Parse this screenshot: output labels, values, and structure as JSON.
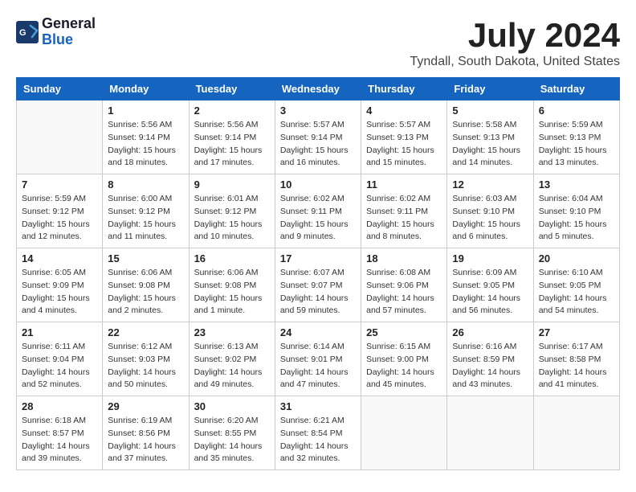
{
  "header": {
    "logo_line1": "General",
    "logo_line2": "Blue",
    "month_year": "July 2024",
    "location": "Tyndall, South Dakota, United States"
  },
  "days_of_week": [
    "Sunday",
    "Monday",
    "Tuesday",
    "Wednesday",
    "Thursday",
    "Friday",
    "Saturday"
  ],
  "weeks": [
    [
      {
        "day": "",
        "sunrise": "",
        "sunset": "",
        "daylight": ""
      },
      {
        "day": "1",
        "sunrise": "Sunrise: 5:56 AM",
        "sunset": "Sunset: 9:14 PM",
        "daylight": "Daylight: 15 hours and 18 minutes."
      },
      {
        "day": "2",
        "sunrise": "Sunrise: 5:56 AM",
        "sunset": "Sunset: 9:14 PM",
        "daylight": "Daylight: 15 hours and 17 minutes."
      },
      {
        "day": "3",
        "sunrise": "Sunrise: 5:57 AM",
        "sunset": "Sunset: 9:14 PM",
        "daylight": "Daylight: 15 hours and 16 minutes."
      },
      {
        "day": "4",
        "sunrise": "Sunrise: 5:57 AM",
        "sunset": "Sunset: 9:13 PM",
        "daylight": "Daylight: 15 hours and 15 minutes."
      },
      {
        "day": "5",
        "sunrise": "Sunrise: 5:58 AM",
        "sunset": "Sunset: 9:13 PM",
        "daylight": "Daylight: 15 hours and 14 minutes."
      },
      {
        "day": "6",
        "sunrise": "Sunrise: 5:59 AM",
        "sunset": "Sunset: 9:13 PM",
        "daylight": "Daylight: 15 hours and 13 minutes."
      }
    ],
    [
      {
        "day": "7",
        "sunrise": "Sunrise: 5:59 AM",
        "sunset": "Sunset: 9:12 PM",
        "daylight": "Daylight: 15 hours and 12 minutes."
      },
      {
        "day": "8",
        "sunrise": "Sunrise: 6:00 AM",
        "sunset": "Sunset: 9:12 PM",
        "daylight": "Daylight: 15 hours and 11 minutes."
      },
      {
        "day": "9",
        "sunrise": "Sunrise: 6:01 AM",
        "sunset": "Sunset: 9:12 PM",
        "daylight": "Daylight: 15 hours and 10 minutes."
      },
      {
        "day": "10",
        "sunrise": "Sunrise: 6:02 AM",
        "sunset": "Sunset: 9:11 PM",
        "daylight": "Daylight: 15 hours and 9 minutes."
      },
      {
        "day": "11",
        "sunrise": "Sunrise: 6:02 AM",
        "sunset": "Sunset: 9:11 PM",
        "daylight": "Daylight: 15 hours and 8 minutes."
      },
      {
        "day": "12",
        "sunrise": "Sunrise: 6:03 AM",
        "sunset": "Sunset: 9:10 PM",
        "daylight": "Daylight: 15 hours and 6 minutes."
      },
      {
        "day": "13",
        "sunrise": "Sunrise: 6:04 AM",
        "sunset": "Sunset: 9:10 PM",
        "daylight": "Daylight: 15 hours and 5 minutes."
      }
    ],
    [
      {
        "day": "14",
        "sunrise": "Sunrise: 6:05 AM",
        "sunset": "Sunset: 9:09 PM",
        "daylight": "Daylight: 15 hours and 4 minutes."
      },
      {
        "day": "15",
        "sunrise": "Sunrise: 6:06 AM",
        "sunset": "Sunset: 9:08 PM",
        "daylight": "Daylight: 15 hours and 2 minutes."
      },
      {
        "day": "16",
        "sunrise": "Sunrise: 6:06 AM",
        "sunset": "Sunset: 9:08 PM",
        "daylight": "Daylight: 15 hours and 1 minute."
      },
      {
        "day": "17",
        "sunrise": "Sunrise: 6:07 AM",
        "sunset": "Sunset: 9:07 PM",
        "daylight": "Daylight: 14 hours and 59 minutes."
      },
      {
        "day": "18",
        "sunrise": "Sunrise: 6:08 AM",
        "sunset": "Sunset: 9:06 PM",
        "daylight": "Daylight: 14 hours and 57 minutes."
      },
      {
        "day": "19",
        "sunrise": "Sunrise: 6:09 AM",
        "sunset": "Sunset: 9:05 PM",
        "daylight": "Daylight: 14 hours and 56 minutes."
      },
      {
        "day": "20",
        "sunrise": "Sunrise: 6:10 AM",
        "sunset": "Sunset: 9:05 PM",
        "daylight": "Daylight: 14 hours and 54 minutes."
      }
    ],
    [
      {
        "day": "21",
        "sunrise": "Sunrise: 6:11 AM",
        "sunset": "Sunset: 9:04 PM",
        "daylight": "Daylight: 14 hours and 52 minutes."
      },
      {
        "day": "22",
        "sunrise": "Sunrise: 6:12 AM",
        "sunset": "Sunset: 9:03 PM",
        "daylight": "Daylight: 14 hours and 50 minutes."
      },
      {
        "day": "23",
        "sunrise": "Sunrise: 6:13 AM",
        "sunset": "Sunset: 9:02 PM",
        "daylight": "Daylight: 14 hours and 49 minutes."
      },
      {
        "day": "24",
        "sunrise": "Sunrise: 6:14 AM",
        "sunset": "Sunset: 9:01 PM",
        "daylight": "Daylight: 14 hours and 47 minutes."
      },
      {
        "day": "25",
        "sunrise": "Sunrise: 6:15 AM",
        "sunset": "Sunset: 9:00 PM",
        "daylight": "Daylight: 14 hours and 45 minutes."
      },
      {
        "day": "26",
        "sunrise": "Sunrise: 6:16 AM",
        "sunset": "Sunset: 8:59 PM",
        "daylight": "Daylight: 14 hours and 43 minutes."
      },
      {
        "day": "27",
        "sunrise": "Sunrise: 6:17 AM",
        "sunset": "Sunset: 8:58 PM",
        "daylight": "Daylight: 14 hours and 41 minutes."
      }
    ],
    [
      {
        "day": "28",
        "sunrise": "Sunrise: 6:18 AM",
        "sunset": "Sunset: 8:57 PM",
        "daylight": "Daylight: 14 hours and 39 minutes."
      },
      {
        "day": "29",
        "sunrise": "Sunrise: 6:19 AM",
        "sunset": "Sunset: 8:56 PM",
        "daylight": "Daylight: 14 hours and 37 minutes."
      },
      {
        "day": "30",
        "sunrise": "Sunrise: 6:20 AM",
        "sunset": "Sunset: 8:55 PM",
        "daylight": "Daylight: 14 hours and 35 minutes."
      },
      {
        "day": "31",
        "sunrise": "Sunrise: 6:21 AM",
        "sunset": "Sunset: 8:54 PM",
        "daylight": "Daylight: 14 hours and 32 minutes."
      },
      {
        "day": "",
        "sunrise": "",
        "sunset": "",
        "daylight": ""
      },
      {
        "day": "",
        "sunrise": "",
        "sunset": "",
        "daylight": ""
      },
      {
        "day": "",
        "sunrise": "",
        "sunset": "",
        "daylight": ""
      }
    ]
  ]
}
